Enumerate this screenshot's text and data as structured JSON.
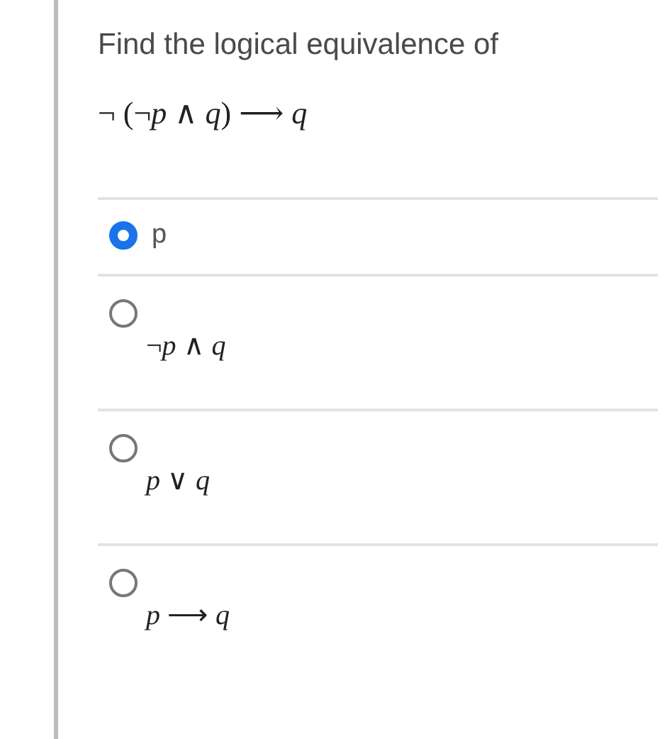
{
  "question": {
    "prompt": "Find the logical equivalence of",
    "formula": "¬ (¬*p* ∧ *q*) ⟶ *q*"
  },
  "options": [
    {
      "kind": "text",
      "label": "p",
      "selected": true
    },
    {
      "kind": "math",
      "label": "¬*p* ∧ *q*",
      "selected": false
    },
    {
      "kind": "math",
      "label": "*p* ∨ *q*",
      "selected": false
    },
    {
      "kind": "math",
      "label": "*p* ⟶ *q*",
      "selected": false
    }
  ]
}
